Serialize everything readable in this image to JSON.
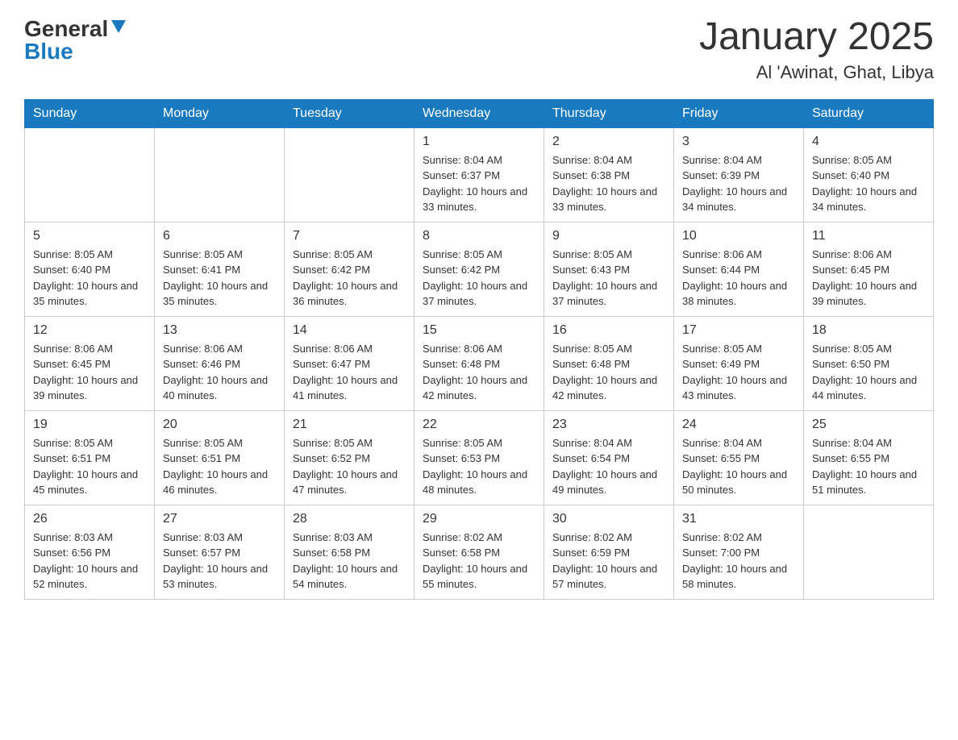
{
  "header": {
    "logo_general": "General",
    "logo_blue": "Blue",
    "month_title": "January 2025",
    "location": "Al 'Awinat, Ghat, Libya"
  },
  "weekdays": [
    "Sunday",
    "Monday",
    "Tuesday",
    "Wednesday",
    "Thursday",
    "Friday",
    "Saturday"
  ],
  "weeks": [
    [
      {
        "day": "",
        "info": ""
      },
      {
        "day": "",
        "info": ""
      },
      {
        "day": "",
        "info": ""
      },
      {
        "day": "1",
        "info": "Sunrise: 8:04 AM\nSunset: 6:37 PM\nDaylight: 10 hours and 33 minutes."
      },
      {
        "day": "2",
        "info": "Sunrise: 8:04 AM\nSunset: 6:38 PM\nDaylight: 10 hours and 33 minutes."
      },
      {
        "day": "3",
        "info": "Sunrise: 8:04 AM\nSunset: 6:39 PM\nDaylight: 10 hours and 34 minutes."
      },
      {
        "day": "4",
        "info": "Sunrise: 8:05 AM\nSunset: 6:40 PM\nDaylight: 10 hours and 34 minutes."
      }
    ],
    [
      {
        "day": "5",
        "info": "Sunrise: 8:05 AM\nSunset: 6:40 PM\nDaylight: 10 hours and 35 minutes."
      },
      {
        "day": "6",
        "info": "Sunrise: 8:05 AM\nSunset: 6:41 PM\nDaylight: 10 hours and 35 minutes."
      },
      {
        "day": "7",
        "info": "Sunrise: 8:05 AM\nSunset: 6:42 PM\nDaylight: 10 hours and 36 minutes."
      },
      {
        "day": "8",
        "info": "Sunrise: 8:05 AM\nSunset: 6:42 PM\nDaylight: 10 hours and 37 minutes."
      },
      {
        "day": "9",
        "info": "Sunrise: 8:05 AM\nSunset: 6:43 PM\nDaylight: 10 hours and 37 minutes."
      },
      {
        "day": "10",
        "info": "Sunrise: 8:06 AM\nSunset: 6:44 PM\nDaylight: 10 hours and 38 minutes."
      },
      {
        "day": "11",
        "info": "Sunrise: 8:06 AM\nSunset: 6:45 PM\nDaylight: 10 hours and 39 minutes."
      }
    ],
    [
      {
        "day": "12",
        "info": "Sunrise: 8:06 AM\nSunset: 6:45 PM\nDaylight: 10 hours and 39 minutes."
      },
      {
        "day": "13",
        "info": "Sunrise: 8:06 AM\nSunset: 6:46 PM\nDaylight: 10 hours and 40 minutes."
      },
      {
        "day": "14",
        "info": "Sunrise: 8:06 AM\nSunset: 6:47 PM\nDaylight: 10 hours and 41 minutes."
      },
      {
        "day": "15",
        "info": "Sunrise: 8:06 AM\nSunset: 6:48 PM\nDaylight: 10 hours and 42 minutes."
      },
      {
        "day": "16",
        "info": "Sunrise: 8:05 AM\nSunset: 6:48 PM\nDaylight: 10 hours and 42 minutes."
      },
      {
        "day": "17",
        "info": "Sunrise: 8:05 AM\nSunset: 6:49 PM\nDaylight: 10 hours and 43 minutes."
      },
      {
        "day": "18",
        "info": "Sunrise: 8:05 AM\nSunset: 6:50 PM\nDaylight: 10 hours and 44 minutes."
      }
    ],
    [
      {
        "day": "19",
        "info": "Sunrise: 8:05 AM\nSunset: 6:51 PM\nDaylight: 10 hours and 45 minutes."
      },
      {
        "day": "20",
        "info": "Sunrise: 8:05 AM\nSunset: 6:51 PM\nDaylight: 10 hours and 46 minutes."
      },
      {
        "day": "21",
        "info": "Sunrise: 8:05 AM\nSunset: 6:52 PM\nDaylight: 10 hours and 47 minutes."
      },
      {
        "day": "22",
        "info": "Sunrise: 8:05 AM\nSunset: 6:53 PM\nDaylight: 10 hours and 48 minutes."
      },
      {
        "day": "23",
        "info": "Sunrise: 8:04 AM\nSunset: 6:54 PM\nDaylight: 10 hours and 49 minutes."
      },
      {
        "day": "24",
        "info": "Sunrise: 8:04 AM\nSunset: 6:55 PM\nDaylight: 10 hours and 50 minutes."
      },
      {
        "day": "25",
        "info": "Sunrise: 8:04 AM\nSunset: 6:55 PM\nDaylight: 10 hours and 51 minutes."
      }
    ],
    [
      {
        "day": "26",
        "info": "Sunrise: 8:03 AM\nSunset: 6:56 PM\nDaylight: 10 hours and 52 minutes."
      },
      {
        "day": "27",
        "info": "Sunrise: 8:03 AM\nSunset: 6:57 PM\nDaylight: 10 hours and 53 minutes."
      },
      {
        "day": "28",
        "info": "Sunrise: 8:03 AM\nSunset: 6:58 PM\nDaylight: 10 hours and 54 minutes."
      },
      {
        "day": "29",
        "info": "Sunrise: 8:02 AM\nSunset: 6:58 PM\nDaylight: 10 hours and 55 minutes."
      },
      {
        "day": "30",
        "info": "Sunrise: 8:02 AM\nSunset: 6:59 PM\nDaylight: 10 hours and 57 minutes."
      },
      {
        "day": "31",
        "info": "Sunrise: 8:02 AM\nSunset: 7:00 PM\nDaylight: 10 hours and 58 minutes."
      },
      {
        "day": "",
        "info": ""
      }
    ]
  ]
}
